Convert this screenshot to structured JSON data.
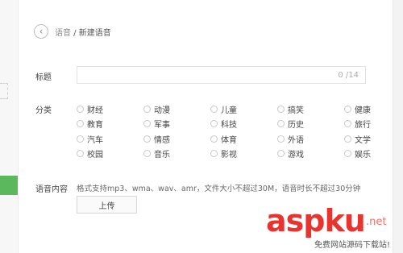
{
  "header": {
    "back_icon": "chevron-left-icon",
    "breadcrumb_parent": "语音",
    "breadcrumb_separator": " / ",
    "breadcrumb_current": "新建语音"
  },
  "form": {
    "title_label": "标题",
    "title_value": "",
    "title_counter": "0 /14",
    "category_label": "分类",
    "categories": [
      "财经",
      "动漫",
      "儿童",
      "搞笑",
      "健康",
      "教育",
      "军事",
      "科技",
      "历史",
      "旅行",
      "汽车",
      "情感",
      "体育",
      "外语",
      "文学",
      "校园",
      "音乐",
      "影视",
      "游戏",
      "娱乐"
    ],
    "selected_category": null,
    "audio_label": "语音内容",
    "audio_hint": "格式支持mp3、wma、wav、amr，文件大小不超过30M，语音时长不超过30分钟",
    "upload_label": "上传"
  },
  "watermark": {
    "main": "aspku",
    "tld": ".net",
    "sub": "免费网站源码下载站!"
  },
  "colors": {
    "accent_green": "#5cb85c",
    "watermark_red": "#e8342f"
  }
}
